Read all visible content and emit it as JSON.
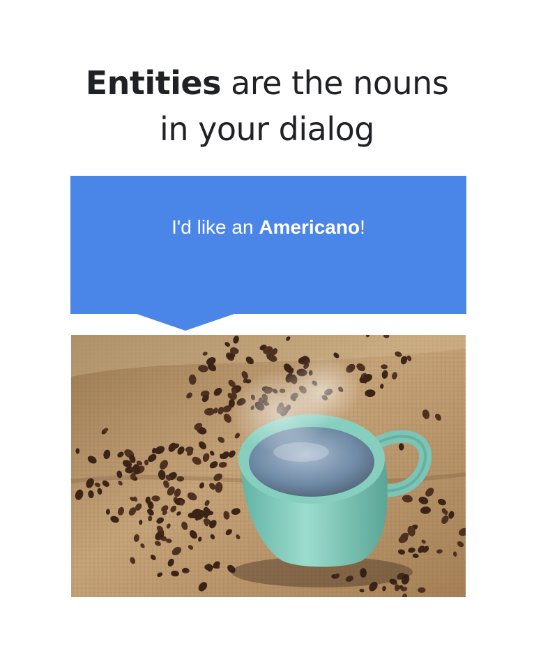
{
  "headline": {
    "line1_bold": "Entities",
    "line1_rest": " are the nouns",
    "line2": "in your dialog"
  },
  "speech_bubble": {
    "prefix": "I'd like an ",
    "entity": "Americano",
    "suffix": "!"
  },
  "photo": {
    "subject": "coffee-cup-on-burlap",
    "colors": {
      "bubble": "#4a86e8",
      "cup": "#8fd1c2",
      "coffee": "#6f8aa6",
      "burlap": "#b08b5c",
      "beans": "#3b2417"
    }
  }
}
